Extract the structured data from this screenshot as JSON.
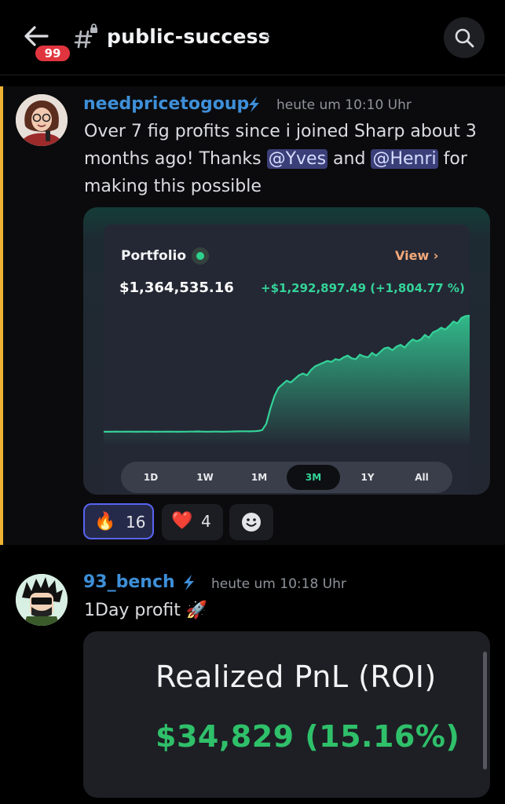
{
  "header": {
    "unread_count": "99",
    "channel_name": "public-success",
    "chevron": "›",
    "icons": {
      "back": "arrow-left-icon",
      "channel": "locked-hashtag-icon",
      "search": "search-icon"
    }
  },
  "messages": [
    {
      "username": "needpricetogoup",
      "timestamp": "heute um 10:10 Uhr",
      "text_part1": "Over 7 fig profits since i joined Sharp about 3 months ago! Thanks ",
      "mention1": "@Yves",
      "text_part2": " and ",
      "mention2": "@Henri",
      "text_part3": " for making this possible",
      "reactions": [
        {
          "emoji": "🔥",
          "count": "16",
          "selected": true
        },
        {
          "emoji": "❤️",
          "count": "4",
          "selected": false
        }
      ],
      "add_reaction_icon": "smiley-add-reaction-icon"
    },
    {
      "username": "93_bench",
      "timestamp": "heute um 10:18 Uhr",
      "text": "1Day profit 🚀"
    }
  ],
  "portfolio": {
    "title": "Portfolio",
    "view_label": "View",
    "view_chevron": "›",
    "value": "$1,364,535.16",
    "gain": "+$1,292,897.49 (+1,804.77 %)",
    "ranges": [
      "1D",
      "1W",
      "1M",
      "3M",
      "1Y",
      "All"
    ],
    "active_range": "3M",
    "accent": "#34d399"
  },
  "chart_data": {
    "type": "area",
    "title": "",
    "xlabel": "",
    "ylabel": "",
    "grid": false,
    "x": [
      0,
      1,
      2,
      3,
      4,
      5,
      6,
      7,
      8,
      9,
      10,
      11,
      12,
      13,
      14,
      15,
      16,
      17,
      18,
      19,
      20,
      21,
      22,
      23,
      24,
      25,
      26,
      27,
      28,
      29,
      30,
      31,
      32,
      33,
      34,
      35,
      36,
      37,
      38,
      39,
      40,
      41,
      42,
      43,
      44,
      45,
      46,
      47,
      48,
      49,
      50,
      51,
      52,
      53,
      54,
      55,
      56,
      57,
      58,
      59,
      60,
      61,
      62,
      63,
      64,
      65,
      66,
      67,
      68,
      69,
      70,
      71,
      72,
      73,
      74,
      75,
      76,
      77,
      78,
      79,
      80,
      81,
      82,
      83,
      84,
      85,
      86,
      87,
      88,
      89,
      90
    ],
    "values": [
      72,
      71,
      72,
      73,
      72,
      72,
      73,
      72,
      71,
      72,
      73,
      72,
      72,
      71,
      72,
      72,
      73,
      72,
      71,
      72,
      72,
      73,
      73,
      74,
      73,
      72,
      72,
      73,
      73,
      72,
      72,
      73,
      74,
      75,
      76,
      76,
      75,
      77,
      80,
      90,
      160,
      330,
      470,
      560,
      600,
      640,
      620,
      660,
      700,
      720,
      700,
      760,
      800,
      820,
      840,
      860,
      850,
      880,
      870,
      900,
      920,
      890,
      880,
      930,
      910,
      900,
      950,
      920,
      960,
      1000,
      1010,
      980,
      1020,
      1040,
      1010,
      1060,
      1100,
      1080,
      1100,
      1150,
      1120,
      1180,
      1200,
      1230,
      1210,
      1250,
      1300,
      1280,
      1340,
      1360,
      1365
    ]
  },
  "pnl": {
    "title": "Realized PnL (ROI)",
    "value": "$34,829 (15.16%)",
    "value_color": "#2fc06a"
  }
}
